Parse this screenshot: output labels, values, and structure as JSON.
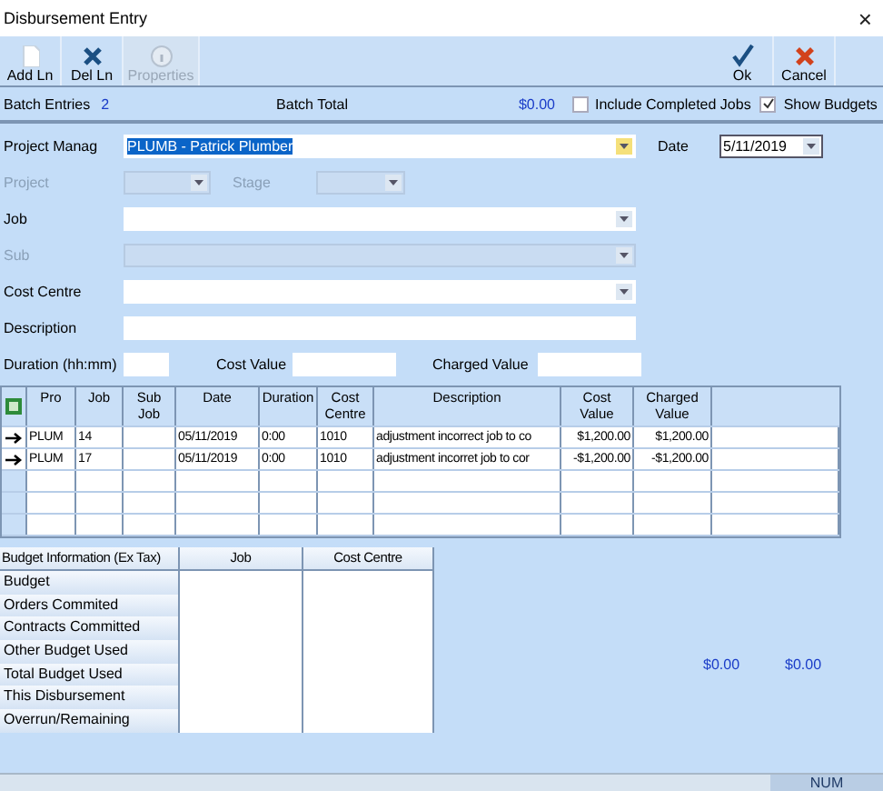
{
  "window": {
    "title": "Disbursement Entry",
    "close": "×"
  },
  "toolbar": {
    "left": [
      {
        "label": "Add Ln",
        "disabled": false
      },
      {
        "label": "Del Ln",
        "disabled": false
      },
      {
        "label": "Properties",
        "disabled": true
      }
    ],
    "right": [
      {
        "label": "Ok",
        "disabled": false
      },
      {
        "label": "Cancel",
        "disabled": false
      }
    ]
  },
  "batch": {
    "entries_label": "Batch Entries",
    "entries": "2",
    "total_label": "Batch Total",
    "total": "$0.00",
    "options": [
      {
        "label": "Include Completed Jobs",
        "checked": false
      },
      {
        "label": "Show Budgets",
        "checked": true
      }
    ]
  },
  "form": {
    "project_manager": {
      "label": "Project Manag",
      "value": "PLUMB - Patrick  Plumber",
      "selected": true
    },
    "date": {
      "label": "Date",
      "value": "5/11/2019"
    },
    "project": {
      "label": "Project",
      "disabled": true
    },
    "stage": {
      "label": "Stage",
      "disabled": true
    },
    "job": {
      "label": "Job",
      "disabled": false
    },
    "sub": {
      "label": "Sub",
      "disabled": true
    },
    "cost_centre": {
      "label": "Cost Centre",
      "disabled": false
    },
    "description": {
      "label": "Description"
    },
    "duration": {
      "label": "Duration (hh:mm)"
    },
    "cost_value": {
      "label": "Cost Value"
    },
    "charged_value": {
      "label": "Charged Value"
    }
  },
  "grid": {
    "columns": [
      "Pro",
      "Job",
      "Sub Job",
      "Date",
      "Duration",
      "Cost Centre",
      "Description",
      "Cost Value",
      "Charged Value"
    ],
    "rows": [
      {
        "cells": [
          "PLUM",
          "14",
          "",
          "05/11/2019",
          "0:00",
          "1010",
          "adjustment incorrect job to co",
          "$1,200.00",
          "$1,200.00"
        ],
        "current": true
      },
      {
        "cells": [
          "PLUM",
          "17",
          "",
          "05/11/2019",
          "0:00",
          "1010",
          "adjustment incorret job to cor",
          "-$1,200.00",
          "-$1,200.00"
        ],
        "current": true
      }
    ]
  },
  "budget": {
    "columns": [
      "Budget Information (Ex Tax)",
      "Job",
      "Cost Centre"
    ],
    "rows": [
      "Budget",
      "Orders Commited",
      "Contracts Committed",
      "Other Budget Used",
      "Total Budget Used",
      "This Disbursement",
      "Overrun/Remaining"
    ]
  },
  "totals": [
    "$0.00",
    "$0.00"
  ],
  "status_bar": {
    "num": "NUM"
  }
}
